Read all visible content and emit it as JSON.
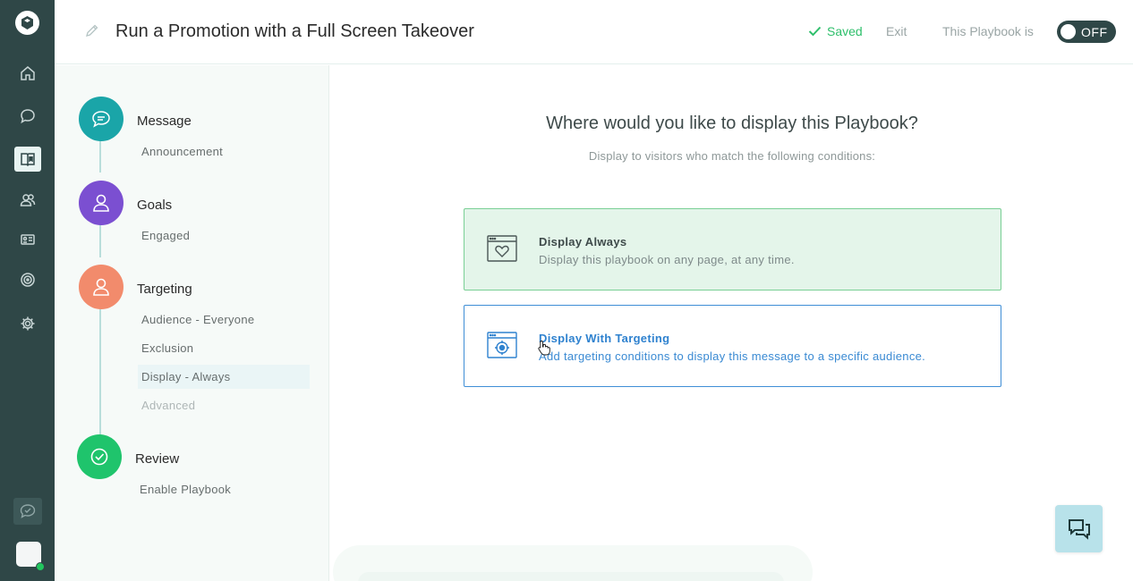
{
  "header": {
    "title": "Run a Promotion with a Full Screen Takeover",
    "saved_label": "Saved",
    "exit_label": "Exit",
    "playbook_status_label": "This Playbook is",
    "toggle_label": "OFF"
  },
  "steps": [
    {
      "title": "Message",
      "icon": "chat-bubble-icon",
      "color": "#1aa5a8",
      "items": [
        {
          "label": "Announcement",
          "state": "normal"
        }
      ]
    },
    {
      "title": "Goals",
      "icon": "person-icon",
      "color": "#7b4fd1",
      "items": [
        {
          "label": "Engaged",
          "state": "normal"
        }
      ]
    },
    {
      "title": "Targeting",
      "icon": "person-icon",
      "color": "#f28b6c",
      "items": [
        {
          "label": "Audience - Everyone",
          "state": "normal"
        },
        {
          "label": "Exclusion",
          "state": "normal"
        },
        {
          "label": "Display - Always",
          "state": "selected"
        },
        {
          "label": "Advanced",
          "state": "muted"
        }
      ]
    },
    {
      "title": "Review",
      "icon": "check-circle-icon",
      "color": "#1fc46c",
      "items": [
        {
          "label": "Enable Playbook",
          "state": "normal"
        }
      ]
    }
  ],
  "main": {
    "title": "Where would you like to display this Playbook?",
    "subtitle": "Display to visitors who match the following conditions:",
    "options": [
      {
        "title": "Display Always",
        "description": "Display this playbook on any page, at any time.",
        "icon": "browser-heart-icon",
        "selected": true
      },
      {
        "title": "Display With Targeting",
        "description": "Add targeting conditions to display this message to a specific audience.",
        "icon": "browser-target-icon",
        "selected": false
      }
    ]
  },
  "colors": {
    "rail": "#2f4747",
    "saved": "#2ebf6b",
    "selected_card_border": "#79cf95",
    "hover_card_border": "#3f8ed6"
  }
}
